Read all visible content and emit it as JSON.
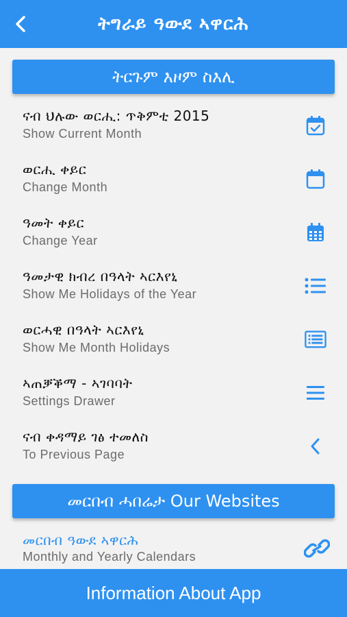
{
  "header": {
    "title": "ትግራይ ዓውደ ኣዋርሕ",
    "back_icon": "chevron-left-icon"
  },
  "section1": {
    "label": "ትርጉም እዞም ስእሊ"
  },
  "menu": [
    {
      "title": "ናብ ህሉው ወርሒ: ጥቅምቲ 2015",
      "subtitle": "Show Current Month",
      "icon": "calendar-check-icon"
    },
    {
      "title": "ወርሒ ቀይር",
      "subtitle": "Change Month",
      "icon": "calendar-blank-icon"
    },
    {
      "title": "ዓመት ቀይር",
      "subtitle": "Change Year",
      "icon": "calendar-grid-icon"
    },
    {
      "title": "ዓመታዊ ክብረ በዓላት ኣርእየኒ",
      "subtitle": "Show Me Holidays of the Year",
      "icon": "list-icon"
    },
    {
      "title": "ወርሓዊ በዓላት ኣርእየኒ",
      "subtitle": "Show Me Month Holidays",
      "icon": "list-box-icon"
    },
    {
      "title": "ኣጠቓቕማ - ኣገባባት",
      "subtitle": "Settings Drawer",
      "icon": "menu-icon"
    },
    {
      "title": "ናብ ቀዳማይ ገፅ ተመለስ",
      "subtitle": "To Previous Page",
      "icon": "chevron-left-icon"
    }
  ],
  "section2": {
    "label": "መርበብ ሓበሬታ Our Websites"
  },
  "website": {
    "title": "መርበብ ዓውደ ኣዋርሕ",
    "subtitle": "Monthly and Yearly Calendars",
    "icon": "link-icon"
  },
  "footer": {
    "label": "Information About App"
  },
  "colors": {
    "accent": "#2e91f0",
    "background": "#f2f2f2",
    "subtitle": "#6b6b6b"
  }
}
